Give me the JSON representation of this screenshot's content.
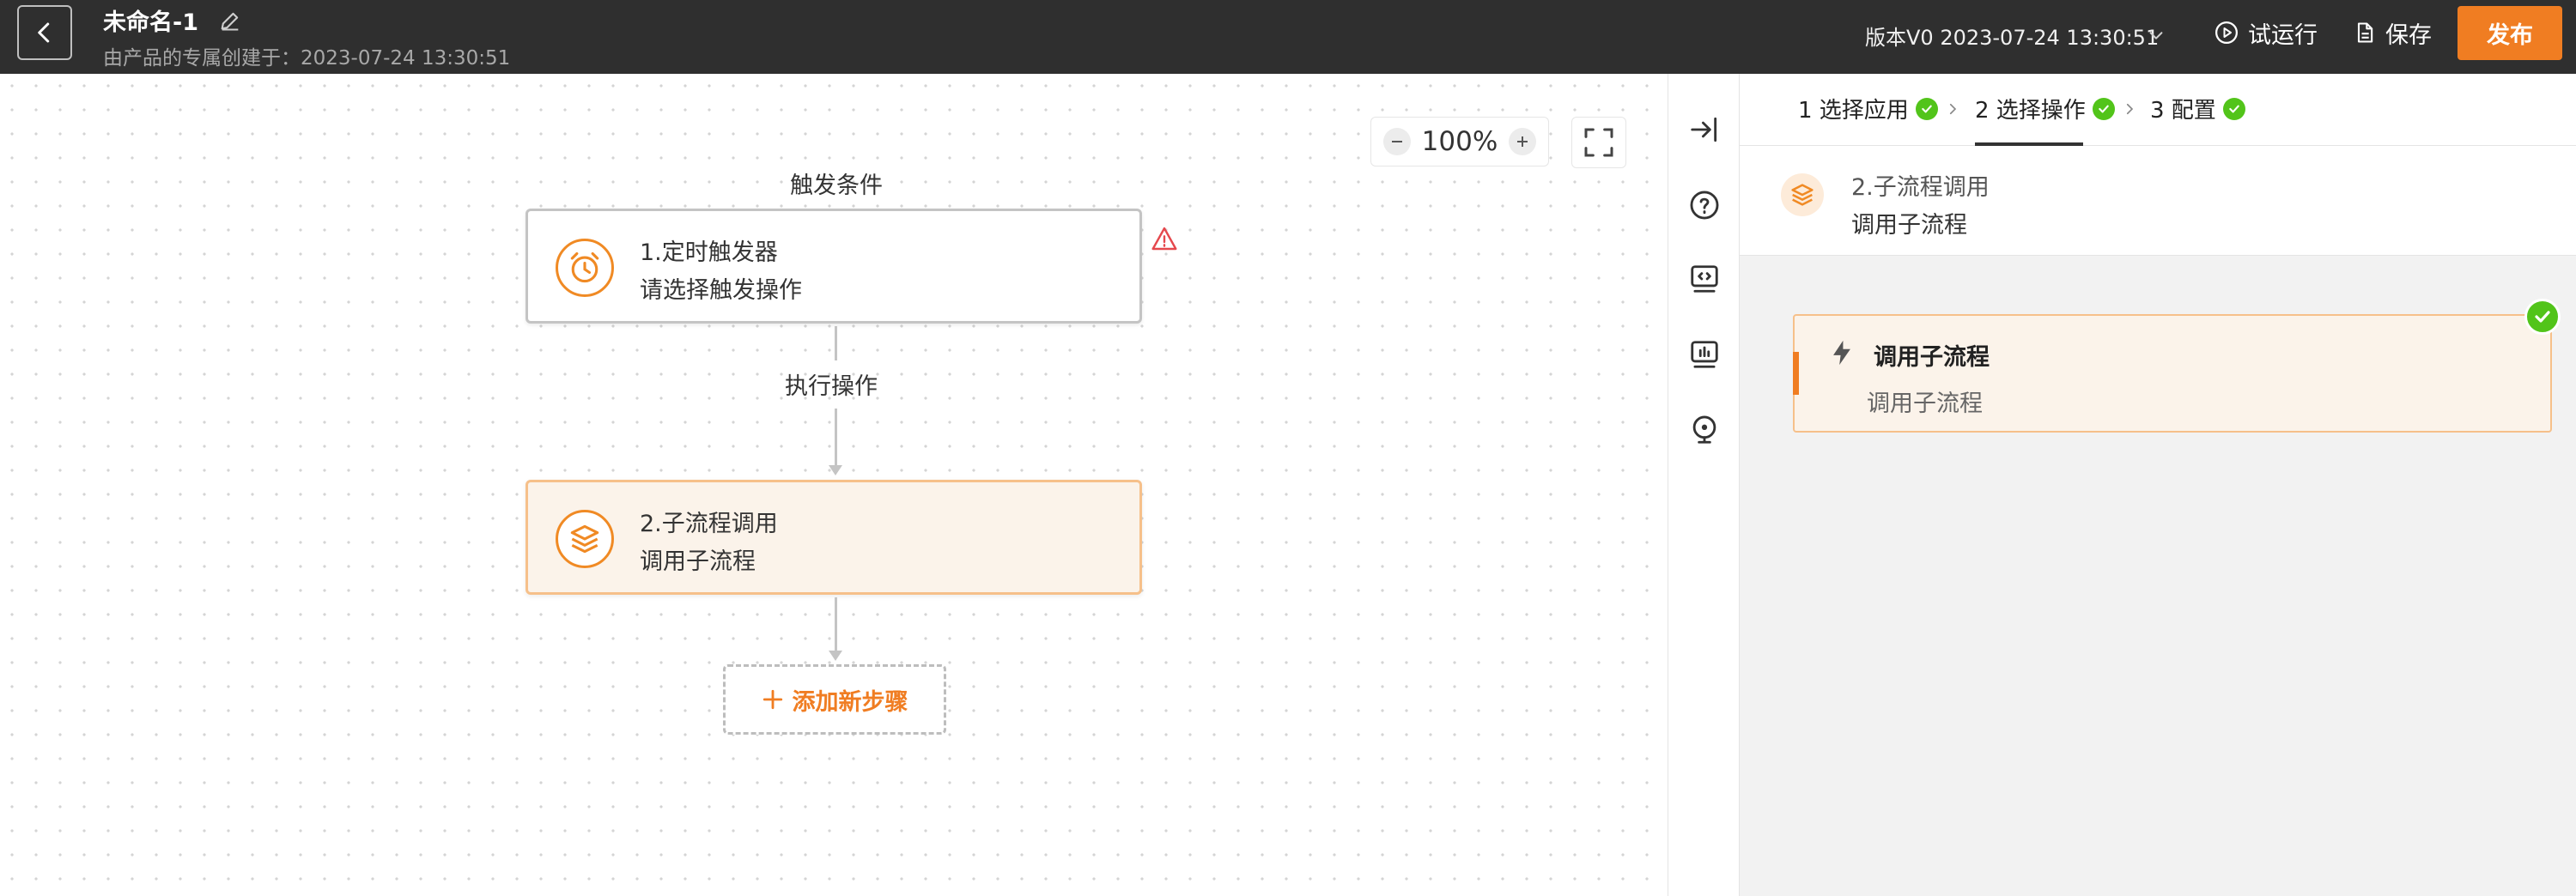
{
  "header": {
    "title": "未命名-1",
    "subtitle": "由产品的专属创建于：2023-07-24 13:30:51",
    "version": "版本V0 2023-07-24 13:30:51",
    "trial_run_label": "试运行",
    "save_label": "保存",
    "publish_label": "发布"
  },
  "canvas": {
    "zoom": "100%",
    "trigger_section_label": "触发条件",
    "action_section_label": "执行操作",
    "trigger_node": {
      "title": "1.定时触发器",
      "description": "请选择触发操作"
    },
    "action_node": {
      "title": "2.子流程调用",
      "description": "调用子流程"
    },
    "add_step_label": "添加新步骤"
  },
  "panel": {
    "steps": [
      {
        "label": "1 选择应用",
        "done": true
      },
      {
        "label": "2 选择操作",
        "done": true,
        "active": true
      },
      {
        "label": "3 配置",
        "done": true
      }
    ],
    "selected": {
      "title": "2.子流程调用",
      "description": "调用子流程"
    },
    "operation": {
      "title": "调用子流程",
      "description": "调用子流程"
    }
  },
  "colors": {
    "topbar": "#2f2f2f",
    "accent": "#f07d22",
    "success": "#52c41a",
    "warning": "#e5484d"
  },
  "icons": [
    "back-icon",
    "edit-icon",
    "chevron-down-icon",
    "play-icon",
    "document-icon",
    "alarm-clock-icon",
    "layers-icon",
    "warning-icon",
    "plus-icon",
    "minus-icon",
    "fullscreen-icon",
    "collapse-panel-icon",
    "help-icon",
    "code-icon",
    "chart-icon",
    "location-icon",
    "check-icon",
    "lightning-icon"
  ]
}
